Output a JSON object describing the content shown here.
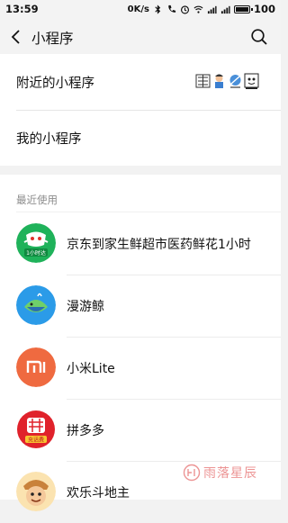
{
  "status_bar": {
    "time": "13:59",
    "net_speed": "0K/s",
    "battery": "100",
    "battery_level": 1.0
  },
  "nav": {
    "title": "小程序",
    "back_icon": "back-arrow-icon",
    "search_icon": "search-icon"
  },
  "menu": {
    "nearby_label": "附近的小程序",
    "mine_label": "我的小程序"
  },
  "recent": {
    "section_label": "最近使用",
    "apps": [
      {
        "name": "京东到家生鲜超市医药鲜花1小时",
        "icon": "jd-daojia-icon",
        "color": "#1fb25a",
        "badge": "1小时达"
      },
      {
        "name": "漫游鲸",
        "icon": "manyoujing-icon",
        "color": "#2b9be8"
      },
      {
        "name": "小米Lite",
        "icon": "mi-logo-icon",
        "color": "#ef6a40",
        "badge": "MI"
      },
      {
        "name": "拼多多",
        "icon": "pinduoduo-icon",
        "color": "#e0222b",
        "badge": "充话费"
      },
      {
        "name": "欢乐斗地主",
        "icon": "doudizhu-icon",
        "color": "#c9823b"
      }
    ]
  },
  "watermark": {
    "text": "雨落星辰"
  }
}
